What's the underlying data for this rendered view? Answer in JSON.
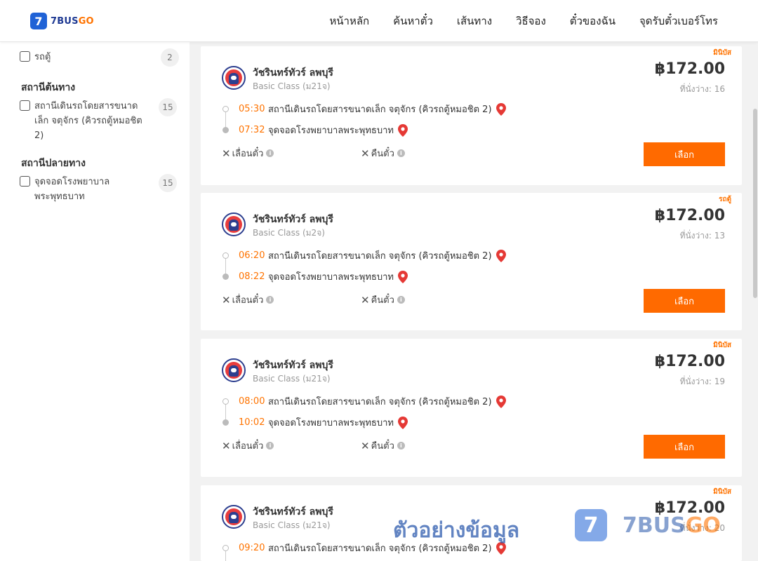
{
  "header": {
    "logo_mark": "7",
    "logo_text_a": "7BUS",
    "logo_text_b": "GO",
    "nav": [
      "หน้าหลัก",
      "ค้นหาตั๋ว",
      "เส้นทาง",
      "วิธีจอง",
      "ตั๋วของฉัน",
      "จุดรับตั๋วเบอร์โทร"
    ]
  },
  "sidebar": {
    "vehicle_item": {
      "label": "รถตู้",
      "count": "2"
    },
    "origin_title": "สถานีต้นทาง",
    "origin_item": {
      "label": "สถานีเดินรถโดยสารขนาดเล็ก จตุจักร (คิวรถตู้หมอชิต 2)",
      "count": "15"
    },
    "dest_title": "สถานีปลายทาง",
    "dest_item": {
      "label": "จุดจอดโรงพยาบาลพระพุทธบาท",
      "count": "15"
    }
  },
  "trips": [
    {
      "badge": "มินิบัส",
      "operator": "วัชรินทร์ทัวร์ ลพบุรี",
      "class": "Basic Class (ม21จ)",
      "price": "฿172.00",
      "seats": "ที่นั่งว่าง: 16",
      "dep_time": "05:30",
      "dep_place": "สถานีเดินรถโดยสารขนาดเล็ก จตุจักร (คิวรถตู้หมอชิต 2)",
      "arr_time": "07:32",
      "arr_place": "จุดจอดโรงพยาบาลพระพุทธบาท",
      "policy1": "เลื่อนตั๋ว",
      "policy2": "คืนตั๋ว",
      "button": "เลือก"
    },
    {
      "badge": "รถตู้",
      "operator": "วัชรินทร์ทัวร์ ลพบุรี",
      "class": "Basic Class (ม2จ)",
      "price": "฿172.00",
      "seats": "ที่นั่งว่าง: 13",
      "dep_time": "06:20",
      "dep_place": "สถานีเดินรถโดยสารขนาดเล็ก จตุจักร (คิวรถตู้หมอชิต 2)",
      "arr_time": "08:22",
      "arr_place": "จุดจอดโรงพยาบาลพระพุทธบาท",
      "policy1": "เลื่อนตั๋ว",
      "policy2": "คืนตั๋ว",
      "button": "เลือก"
    },
    {
      "badge": "มินิบัส",
      "operator": "วัชรินทร์ทัวร์ ลพบุรี",
      "class": "Basic Class (ม21จ)",
      "price": "฿172.00",
      "seats": "ที่นั่งว่าง: 19",
      "dep_time": "08:00",
      "dep_place": "สถานีเดินรถโดยสารขนาดเล็ก จตุจักร (คิวรถตู้หมอชิต 2)",
      "arr_time": "10:02",
      "arr_place": "จุดจอดโรงพยาบาลพระพุทธบาท",
      "policy1": "เลื่อนตั๋ว",
      "policy2": "คืนตั๋ว",
      "button": "เลือก"
    },
    {
      "badge": "มินิบัส",
      "operator": "วัชรินทร์ทัวร์ ลพบุรี",
      "class": "Basic Class (ม21จ)",
      "price": "฿172.00",
      "seats": "ที่นั่งว่าง: 20",
      "dep_time": "09:20",
      "dep_place": "สถานีเดินรถโดยสารขนาดเล็ก จตุจักร (คิวรถตู้หมอชิต 2)"
    }
  ],
  "watermark": {
    "text": "ตัวอย่างข้อมูล",
    "mark": "7",
    "brand_a": "7BUS",
    "brand_b": "GO"
  },
  "colors": {
    "accent": "#ff6a00",
    "brand_blue": "#1f62d6",
    "time_orange": "#ff7300",
    "pin_red": "#e53935"
  }
}
